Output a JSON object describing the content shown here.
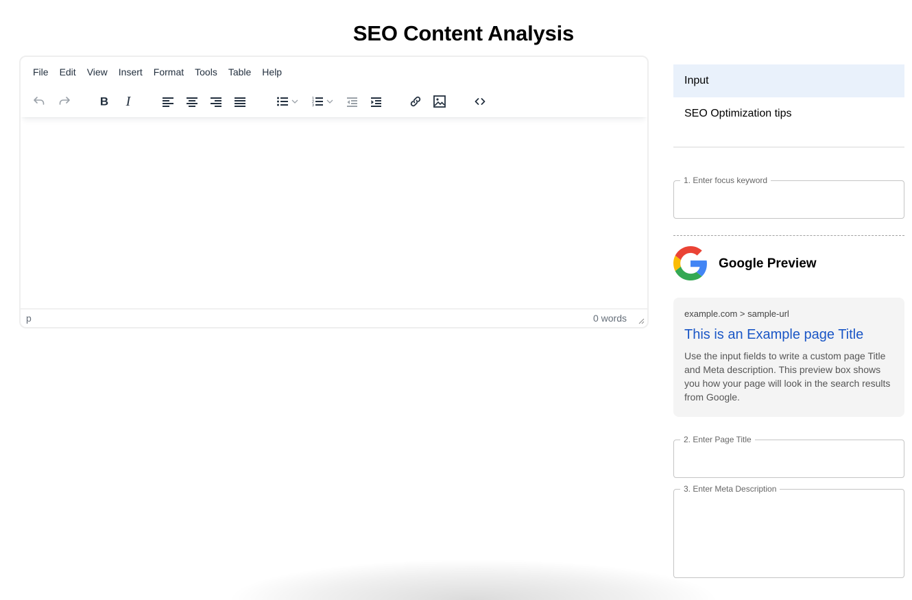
{
  "page": {
    "title": "SEO Content Analysis"
  },
  "editor": {
    "menu": [
      "File",
      "Edit",
      "View",
      "Insert",
      "Format",
      "Tools",
      "Table",
      "Help"
    ],
    "toolbar": [
      {
        "name": "undo-icon",
        "label": "Undo",
        "state": "disabled"
      },
      {
        "name": "redo-icon",
        "label": "Redo",
        "state": "disabled"
      },
      {
        "name": "bold-icon",
        "label": "Bold"
      },
      {
        "name": "italic-icon",
        "label": "Italic"
      },
      {
        "name": "align-left-icon",
        "label": "Align left"
      },
      {
        "name": "align-center-icon",
        "label": "Align center"
      },
      {
        "name": "align-right-icon",
        "label": "Align right"
      },
      {
        "name": "justify-icon",
        "label": "Justify"
      },
      {
        "name": "bullet-list-icon",
        "label": "Bullet list"
      },
      {
        "name": "numbered-list-icon",
        "label": "Numbered list"
      },
      {
        "name": "outdent-icon",
        "label": "Decrease indent",
        "state": "disabled"
      },
      {
        "name": "indent-icon",
        "label": "Increase indent"
      },
      {
        "name": "link-icon",
        "label": "Insert link"
      },
      {
        "name": "image-icon",
        "label": "Insert image"
      },
      {
        "name": "code-icon",
        "label": "Source code"
      }
    ],
    "content": "",
    "status_path": "p",
    "word_count": "0 words"
  },
  "sidebar": {
    "tabs": [
      {
        "label": "Input",
        "active": true
      },
      {
        "label": "SEO Optimization tips",
        "active": false
      }
    ],
    "focus_keyword": {
      "label": "1. Enter focus keyword",
      "value": ""
    },
    "google_preview": {
      "heading": "Google Preview",
      "url": "example.com > sample-url",
      "title": "This is an Example page Title",
      "description": "Use the input fields to write a custom page Title and Meta description. This preview box shows you how your page will look in the search results from Google."
    },
    "page_title": {
      "label": "2. Enter Page Title",
      "value": ""
    },
    "meta_description": {
      "label": "3. Enter Meta Description",
      "value": ""
    }
  },
  "colors": {
    "active_tab_bg": "#e9f1fb",
    "link_blue": "#1a56c6",
    "google_red": "#ea4335",
    "google_yellow": "#fbbc05",
    "google_green": "#34a853",
    "google_blue": "#4285f4"
  }
}
